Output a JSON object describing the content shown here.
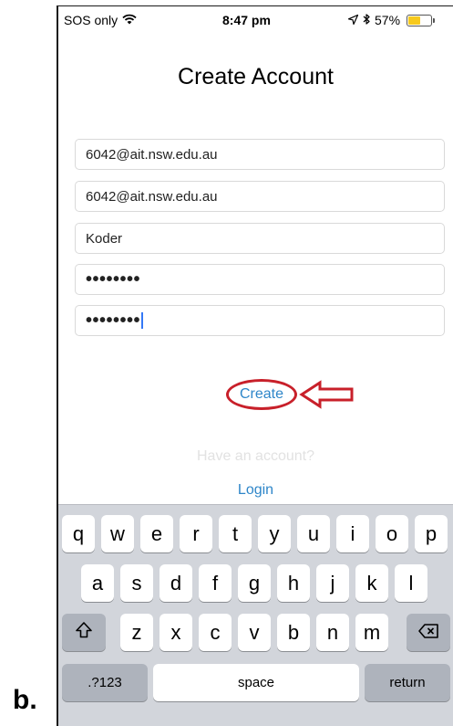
{
  "figure_label": "b.",
  "status_bar": {
    "carrier": "SOS only",
    "time": "8:47 pm",
    "battery_percent": "57%",
    "battery_level": 0.57
  },
  "screen": {
    "title": "Create Account",
    "fields": [
      {
        "value": "6042@ait.nsw.edu.au",
        "type": "email"
      },
      {
        "value": "6042@ait.nsw.edu.au",
        "type": "email-confirm"
      },
      {
        "value": "Koder",
        "type": "name"
      },
      {
        "value": "••••••••",
        "type": "password"
      },
      {
        "value": "••••••••",
        "type": "password-confirm"
      }
    ],
    "create_label": "Create",
    "have_account_text": "Have an account?",
    "login_label": "Login"
  },
  "keyboard": {
    "row1": [
      "q",
      "w",
      "e",
      "r",
      "t",
      "y",
      "u",
      "i",
      "o",
      "p"
    ],
    "row2": [
      "a",
      "s",
      "d",
      "f",
      "g",
      "h",
      "j",
      "k",
      "l"
    ],
    "row3": [
      "z",
      "x",
      "c",
      "v",
      "b",
      "n",
      "m"
    ],
    "shift_icon": "shift-icon",
    "backspace_icon": "backspace-icon",
    "numbers_label": ".?123",
    "space_label": "space",
    "return_label": "return"
  },
  "colors": {
    "link": "#2e86c9",
    "annotation": "#c8202a",
    "battery": "#f7c91c",
    "keyboard_bg": "#d2d5db"
  }
}
